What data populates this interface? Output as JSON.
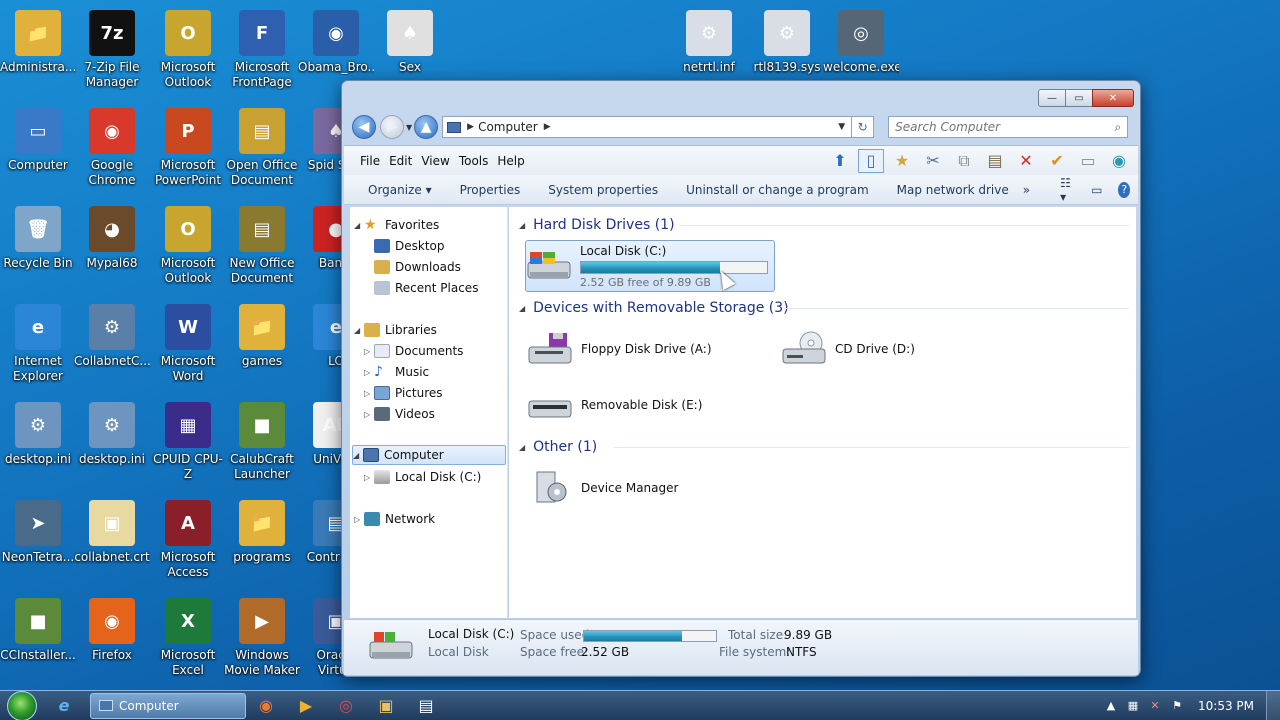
{
  "desktop": {
    "icons": [
      {
        "label": "Administra...",
        "glyph": "📁",
        "color": "#e0b23c"
      },
      {
        "label": "7-Zip File Manager",
        "glyph": "7z",
        "color": "#111111"
      },
      {
        "label": "Microsoft Outlook",
        "glyph": "O",
        "color": "#c8a52e"
      },
      {
        "label": "Microsoft FrontPage",
        "glyph": "F",
        "color": "#2f5fb0"
      },
      {
        "label": "Obama_Bro...",
        "glyph": "◉",
        "color": "#2a5ea8"
      },
      {
        "label": "Sex",
        "glyph": "♠",
        "color": "#e0e0e0"
      },
      {
        "label": "netrtl.inf",
        "glyph": "⚙",
        "color": "#d8dde6"
      },
      {
        "label": "rtl8139.sys",
        "glyph": "⚙",
        "color": "#d8dde6"
      },
      {
        "label": "welcome.exe",
        "glyph": "◎",
        "color": "#556677"
      },
      {
        "label": "Computer",
        "glyph": "▭",
        "color": "#3a78c8"
      },
      {
        "label": "Google Chrome",
        "glyph": "◉",
        "color": "#d8392b"
      },
      {
        "label": "Microsoft PowerPoint",
        "glyph": "P",
        "color": "#c9481f"
      },
      {
        "label": "Open Office Document",
        "glyph": "▤",
        "color": "#c9a032"
      },
      {
        "label": "Spid Solit",
        "glyph": "♠",
        "color": "#7a6aa0"
      },
      {
        "label": "Recycle Bin",
        "glyph": "🗑",
        "color": "#7fa6c8"
      },
      {
        "label": "Mypal68",
        "glyph": "◕",
        "color": "#6a4a2a"
      },
      {
        "label": "Microsoft Outlook",
        "glyph": "O",
        "color": "#c8a52e"
      },
      {
        "label": "New Office Document",
        "glyph": "▤",
        "color": "#8a7a30"
      },
      {
        "label": "Bandi",
        "glyph": "●",
        "color": "#c22"
      },
      {
        "label": "Internet Explorer",
        "glyph": "e",
        "color": "#2b86d8"
      },
      {
        "label": "CollabnetC...",
        "glyph": "⚙",
        "color": "#5a7fa8"
      },
      {
        "label": "Microsoft Word",
        "glyph": "W",
        "color": "#2b4ea0"
      },
      {
        "label": "games",
        "glyph": "📁",
        "color": "#e0b23c"
      },
      {
        "label": "LO",
        "glyph": "e",
        "color": "#2b86d8"
      },
      {
        "label": "desktop.ini",
        "glyph": "⚙",
        "color": "#6d95c0"
      },
      {
        "label": "desktop.ini",
        "glyph": "⚙",
        "color": "#6d95c0"
      },
      {
        "label": "CPUID CPU-Z",
        "glyph": "▦",
        "color": "#3b2c8a"
      },
      {
        "label": "CalubCraft Launcher",
        "glyph": "■",
        "color": "#5a8a3a"
      },
      {
        "label": "UniVGA",
        "glyph": "Ab",
        "color": "#f0f0f0"
      },
      {
        "label": "NeonTetra...",
        "glyph": "➤",
        "color": "#4a6a8a"
      },
      {
        "label": "collabnet.crt",
        "glyph": "▣",
        "color": "#e8d9a0"
      },
      {
        "label": "Microsoft Access",
        "glyph": "A",
        "color": "#8a1f2a"
      },
      {
        "label": "programs",
        "glyph": "📁",
        "color": "#e0b23c"
      },
      {
        "label": "Contr Pan",
        "glyph": "▤",
        "color": "#3a7ab8"
      },
      {
        "label": "CCInstaller...",
        "glyph": "■",
        "color": "#5a8a3a"
      },
      {
        "label": "Firefox",
        "glyph": "◉",
        "color": "#e5641c"
      },
      {
        "label": "Microsoft Excel",
        "glyph": "X",
        "color": "#1e7a3a"
      },
      {
        "label": "Windows Movie Maker",
        "glyph": "▶",
        "color": "#b06a2a"
      },
      {
        "label": "Oracle Virtua",
        "glyph": "▣",
        "color": "#3a5a9a"
      }
    ]
  },
  "window": {
    "address": {
      "crumb": "Computer",
      "back_label": "◀",
      "forward_label": "▶",
      "up_label": "▲"
    },
    "search": {
      "placeholder": "Search Computer"
    },
    "menu": [
      "File",
      "Edit",
      "View",
      "Tools",
      "Help"
    ],
    "commands": [
      "Organize ▾",
      "Properties",
      "System properties",
      "Uninstall or change a program",
      "Map network drive",
      "»"
    ],
    "nav": {
      "favorites": "Favorites",
      "favorites_items": [
        "Desktop",
        "Downloads",
        "Recent Places"
      ],
      "libraries": "Libraries",
      "libraries_items": [
        "Documents",
        "Music",
        "Pictures",
        "Videos"
      ],
      "computer": "Computer",
      "computer_items": [
        "Local Disk (C:)"
      ],
      "network": "Network"
    },
    "groups": {
      "hdd": "Hard Disk Drives (1)",
      "removable": "Devices with Removable Storage (3)",
      "other": "Other (1)"
    },
    "drives": {
      "c": {
        "name": "Local Disk (C:)",
        "free": "2.52 GB free of 9.89 GB",
        "used_fraction": 0.745
      },
      "a": {
        "name": "Floppy Disk Drive (A:)"
      },
      "d": {
        "name": "CD Drive (D:)"
      },
      "e": {
        "name": "Removable Disk (E:)"
      },
      "dm": {
        "name": "Device Manager"
      }
    },
    "details": {
      "name": "Local Disk (C:)",
      "type": "Local Disk",
      "space_used_label": "Space used:",
      "space_free_label": "Space free:",
      "space_free": "2.52 GB",
      "total_size_label": "Total size:",
      "total_size": "9.89 GB",
      "fs_label": "File system:",
      "fs": "NTFS",
      "used_fraction": 0.745
    }
  },
  "taskbar": {
    "task_label": "Computer",
    "clock": "10:53 PM",
    "pinned": [
      "ie-icon",
      "explorer-icon"
    ]
  }
}
